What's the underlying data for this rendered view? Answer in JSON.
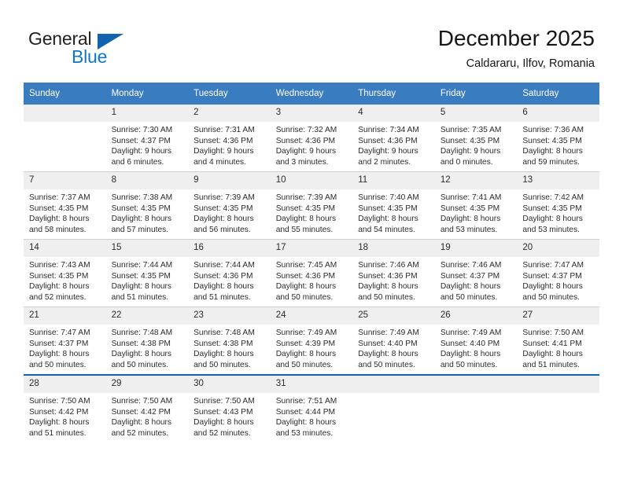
{
  "brand": {
    "name_part1": "General",
    "name_part2": "Blue",
    "logo_icon": "blue-triangle-icon",
    "color_dark": "#231f20",
    "color_blue": "#1277cc"
  },
  "header": {
    "title": "December 2025",
    "location": "Caldararu, Ilfov, Romania"
  },
  "theme": {
    "header_bg": "#3a7cc0",
    "daynum_bg": "#efefef",
    "accent_line": "#1263ae",
    "row_divider": "#cfcfcf"
  },
  "weekday_headers": [
    "Sunday",
    "Monday",
    "Tuesday",
    "Wednesday",
    "Thursday",
    "Friday",
    "Saturday"
  ],
  "weeks": [
    [
      {
        "day": "",
        "sunrise": "",
        "sunset": "",
        "daylight_line1": "",
        "daylight_line2": ""
      },
      {
        "day": "1",
        "sunrise": "Sunrise: 7:30 AM",
        "sunset": "Sunset: 4:37 PM",
        "daylight_line1": "Daylight: 9 hours",
        "daylight_line2": "and 6 minutes."
      },
      {
        "day": "2",
        "sunrise": "Sunrise: 7:31 AM",
        "sunset": "Sunset: 4:36 PM",
        "daylight_line1": "Daylight: 9 hours",
        "daylight_line2": "and 4 minutes."
      },
      {
        "day": "3",
        "sunrise": "Sunrise: 7:32 AM",
        "sunset": "Sunset: 4:36 PM",
        "daylight_line1": "Daylight: 9 hours",
        "daylight_line2": "and 3 minutes."
      },
      {
        "day": "4",
        "sunrise": "Sunrise: 7:34 AM",
        "sunset": "Sunset: 4:36 PM",
        "daylight_line1": "Daylight: 9 hours",
        "daylight_line2": "and 2 minutes."
      },
      {
        "day": "5",
        "sunrise": "Sunrise: 7:35 AM",
        "sunset": "Sunset: 4:35 PM",
        "daylight_line1": "Daylight: 9 hours",
        "daylight_line2": "and 0 minutes."
      },
      {
        "day": "6",
        "sunrise": "Sunrise: 7:36 AM",
        "sunset": "Sunset: 4:35 PM",
        "daylight_line1": "Daylight: 8 hours",
        "daylight_line2": "and 59 minutes."
      }
    ],
    [
      {
        "day": "7",
        "sunrise": "Sunrise: 7:37 AM",
        "sunset": "Sunset: 4:35 PM",
        "daylight_line1": "Daylight: 8 hours",
        "daylight_line2": "and 58 minutes."
      },
      {
        "day": "8",
        "sunrise": "Sunrise: 7:38 AM",
        "sunset": "Sunset: 4:35 PM",
        "daylight_line1": "Daylight: 8 hours",
        "daylight_line2": "and 57 minutes."
      },
      {
        "day": "9",
        "sunrise": "Sunrise: 7:39 AM",
        "sunset": "Sunset: 4:35 PM",
        "daylight_line1": "Daylight: 8 hours",
        "daylight_line2": "and 56 minutes."
      },
      {
        "day": "10",
        "sunrise": "Sunrise: 7:39 AM",
        "sunset": "Sunset: 4:35 PM",
        "daylight_line1": "Daylight: 8 hours",
        "daylight_line2": "and 55 minutes."
      },
      {
        "day": "11",
        "sunrise": "Sunrise: 7:40 AM",
        "sunset": "Sunset: 4:35 PM",
        "daylight_line1": "Daylight: 8 hours",
        "daylight_line2": "and 54 minutes."
      },
      {
        "day": "12",
        "sunrise": "Sunrise: 7:41 AM",
        "sunset": "Sunset: 4:35 PM",
        "daylight_line1": "Daylight: 8 hours",
        "daylight_line2": "and 53 minutes."
      },
      {
        "day": "13",
        "sunrise": "Sunrise: 7:42 AM",
        "sunset": "Sunset: 4:35 PM",
        "daylight_line1": "Daylight: 8 hours",
        "daylight_line2": "and 53 minutes."
      }
    ],
    [
      {
        "day": "14",
        "sunrise": "Sunrise: 7:43 AM",
        "sunset": "Sunset: 4:35 PM",
        "daylight_line1": "Daylight: 8 hours",
        "daylight_line2": "and 52 minutes."
      },
      {
        "day": "15",
        "sunrise": "Sunrise: 7:44 AM",
        "sunset": "Sunset: 4:35 PM",
        "daylight_line1": "Daylight: 8 hours",
        "daylight_line2": "and 51 minutes."
      },
      {
        "day": "16",
        "sunrise": "Sunrise: 7:44 AM",
        "sunset": "Sunset: 4:36 PM",
        "daylight_line1": "Daylight: 8 hours",
        "daylight_line2": "and 51 minutes."
      },
      {
        "day": "17",
        "sunrise": "Sunrise: 7:45 AM",
        "sunset": "Sunset: 4:36 PM",
        "daylight_line1": "Daylight: 8 hours",
        "daylight_line2": "and 50 minutes."
      },
      {
        "day": "18",
        "sunrise": "Sunrise: 7:46 AM",
        "sunset": "Sunset: 4:36 PM",
        "daylight_line1": "Daylight: 8 hours",
        "daylight_line2": "and 50 minutes."
      },
      {
        "day": "19",
        "sunrise": "Sunrise: 7:46 AM",
        "sunset": "Sunset: 4:37 PM",
        "daylight_line1": "Daylight: 8 hours",
        "daylight_line2": "and 50 minutes."
      },
      {
        "day": "20",
        "sunrise": "Sunrise: 7:47 AM",
        "sunset": "Sunset: 4:37 PM",
        "daylight_line1": "Daylight: 8 hours",
        "daylight_line2": "and 50 minutes."
      }
    ],
    [
      {
        "day": "21",
        "sunrise": "Sunrise: 7:47 AM",
        "sunset": "Sunset: 4:37 PM",
        "daylight_line1": "Daylight: 8 hours",
        "daylight_line2": "and 50 minutes."
      },
      {
        "day": "22",
        "sunrise": "Sunrise: 7:48 AM",
        "sunset": "Sunset: 4:38 PM",
        "daylight_line1": "Daylight: 8 hours",
        "daylight_line2": "and 50 minutes."
      },
      {
        "day": "23",
        "sunrise": "Sunrise: 7:48 AM",
        "sunset": "Sunset: 4:38 PM",
        "daylight_line1": "Daylight: 8 hours",
        "daylight_line2": "and 50 minutes."
      },
      {
        "day": "24",
        "sunrise": "Sunrise: 7:49 AM",
        "sunset": "Sunset: 4:39 PM",
        "daylight_line1": "Daylight: 8 hours",
        "daylight_line2": "and 50 minutes."
      },
      {
        "day": "25",
        "sunrise": "Sunrise: 7:49 AM",
        "sunset": "Sunset: 4:40 PM",
        "daylight_line1": "Daylight: 8 hours",
        "daylight_line2": "and 50 minutes."
      },
      {
        "day": "26",
        "sunrise": "Sunrise: 7:49 AM",
        "sunset": "Sunset: 4:40 PM",
        "daylight_line1": "Daylight: 8 hours",
        "daylight_line2": "and 50 minutes."
      },
      {
        "day": "27",
        "sunrise": "Sunrise: 7:50 AM",
        "sunset": "Sunset: 4:41 PM",
        "daylight_line1": "Daylight: 8 hours",
        "daylight_line2": "and 51 minutes."
      }
    ],
    [
      {
        "day": "28",
        "sunrise": "Sunrise: 7:50 AM",
        "sunset": "Sunset: 4:42 PM",
        "daylight_line1": "Daylight: 8 hours",
        "daylight_line2": "and 51 minutes."
      },
      {
        "day": "29",
        "sunrise": "Sunrise: 7:50 AM",
        "sunset": "Sunset: 4:42 PM",
        "daylight_line1": "Daylight: 8 hours",
        "daylight_line2": "and 52 minutes."
      },
      {
        "day": "30",
        "sunrise": "Sunrise: 7:50 AM",
        "sunset": "Sunset: 4:43 PM",
        "daylight_line1": "Daylight: 8 hours",
        "daylight_line2": "and 52 minutes."
      },
      {
        "day": "31",
        "sunrise": "Sunrise: 7:51 AM",
        "sunset": "Sunset: 4:44 PM",
        "daylight_line1": "Daylight: 8 hours",
        "daylight_line2": "and 53 minutes."
      },
      {
        "day": "",
        "sunrise": "",
        "sunset": "",
        "daylight_line1": "",
        "daylight_line2": ""
      },
      {
        "day": "",
        "sunrise": "",
        "sunset": "",
        "daylight_line1": "",
        "daylight_line2": ""
      },
      {
        "day": "",
        "sunrise": "",
        "sunset": "",
        "daylight_line1": "",
        "daylight_line2": ""
      }
    ]
  ]
}
